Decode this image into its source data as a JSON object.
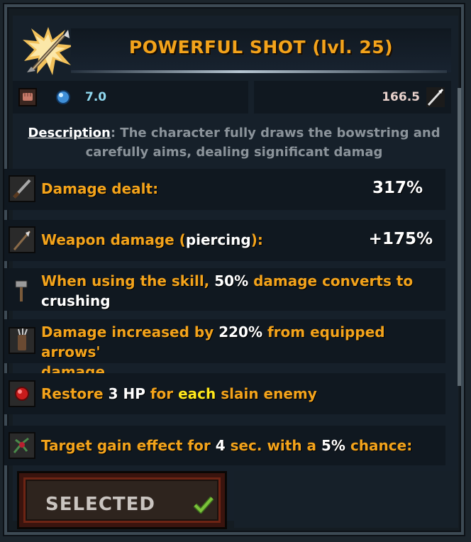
{
  "skill": {
    "title": "POWERFUL SHOT (lvl. 25)",
    "icon": "arrow-burst-icon",
    "mana_cost": "7.0",
    "range": "166.5"
  },
  "description": {
    "label": "Description",
    "text": ": The character fully draws the bowstring and carefully aims, dealing significant damag"
  },
  "effects": [
    {
      "icon": "sword-icon",
      "label": "Damage dealt:",
      "value": "317%"
    },
    {
      "icon": "spear-icon",
      "label_a": "Weapon damage (",
      "label_b": "piercing",
      "label_c": "):",
      "value": "+175%"
    },
    {
      "icon": "hammer-icon",
      "a": "When using the skill, ",
      "b": "50%",
      "c": " damage converts to",
      "d": "crushing"
    },
    {
      "icon": "quiver-icon",
      "a": "Damage increased by ",
      "b": "220%",
      "c": " from equipped arrows'",
      "d": "damage"
    },
    {
      "icon": "blood-gem-icon",
      "a": "Restore ",
      "b": "3",
      "c": " ",
      "d": "HP",
      "e": " for ",
      "f": "each",
      "g": " slain enemy"
    },
    {
      "icon": "thorn-icon",
      "a": "Target gain effect for ",
      "b": "4",
      "c": " sec. with a ",
      "d": "5%",
      "e": " chance:"
    }
  ],
  "button": {
    "label": "SELECTED"
  },
  "colors": {
    "accent": "#f3a31b",
    "highlight": "#ffe81c",
    "mana": "#8fd7ee"
  }
}
